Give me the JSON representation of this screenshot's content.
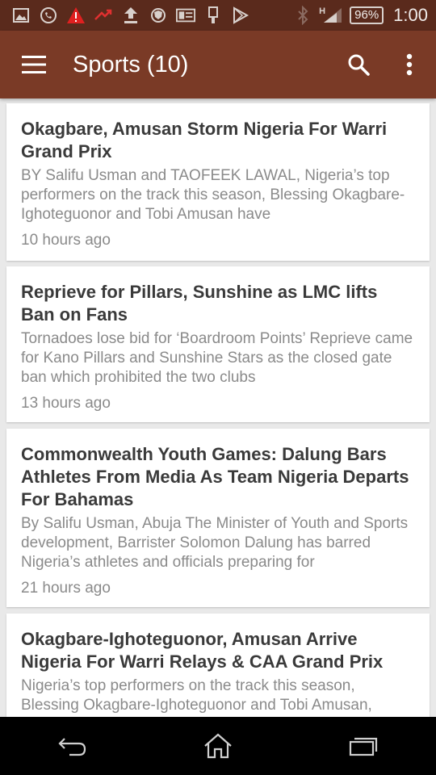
{
  "status_bar": {
    "battery": "96%",
    "time": "1:00",
    "network": "H",
    "icons": [
      "gallery-icon",
      "whatsapp-icon",
      "warning-icon",
      "missed-call-icon",
      "upload-icon",
      "shield-icon",
      "news-icon",
      "usb-icon",
      "play-store-icon",
      "bluetooth-icon",
      "signal-icon"
    ]
  },
  "app_bar": {
    "title": "Sports (10)",
    "background": "#7a3a26",
    "status_background": "#5a2a1c"
  },
  "articles": [
    {
      "title": "Okagbare, Amusan Storm Nigeria For Warri Grand Prix",
      "summary": "BY Salifu Usman and TAOFEEK LAWAL, Nigeria’s top performers on the track this season, Blessing Okagbare-Ighoteguonor and Tobi Amusan have",
      "time": "10 hours ago"
    },
    {
      "title": "Reprieve for Pillars, Sunshine as LMC lifts Ban on Fans",
      "summary": "Tornadoes lose bid for ‘Boardroom Points’ Reprieve came for Kano Pillars and Sunshine Stars as the closed gate ban which prohibited the two clubs",
      "time": "13 hours ago"
    },
    {
      "title": "Commonwealth Youth Games: Dalung Bars Athletes From Media As Team Nigeria Departs For Bahamas",
      "summary": "By Salifu Usman, Abuja The Minister of Youth and Sports development, Barrister Solomon Dalung has barred Nigeria’s athletes and officials preparing for",
      "time": "21 hours ago"
    },
    {
      "title": "Okagbare-Ighoteguonor, Amusan Arrive Nigeria For Warri Relays & CAA Grand Prix",
      "summary": "Nigeria’s top performers on the track this season, Blessing Okagbare-Ighoteguonor and Tobi Amusan,",
      "time": ""
    }
  ]
}
